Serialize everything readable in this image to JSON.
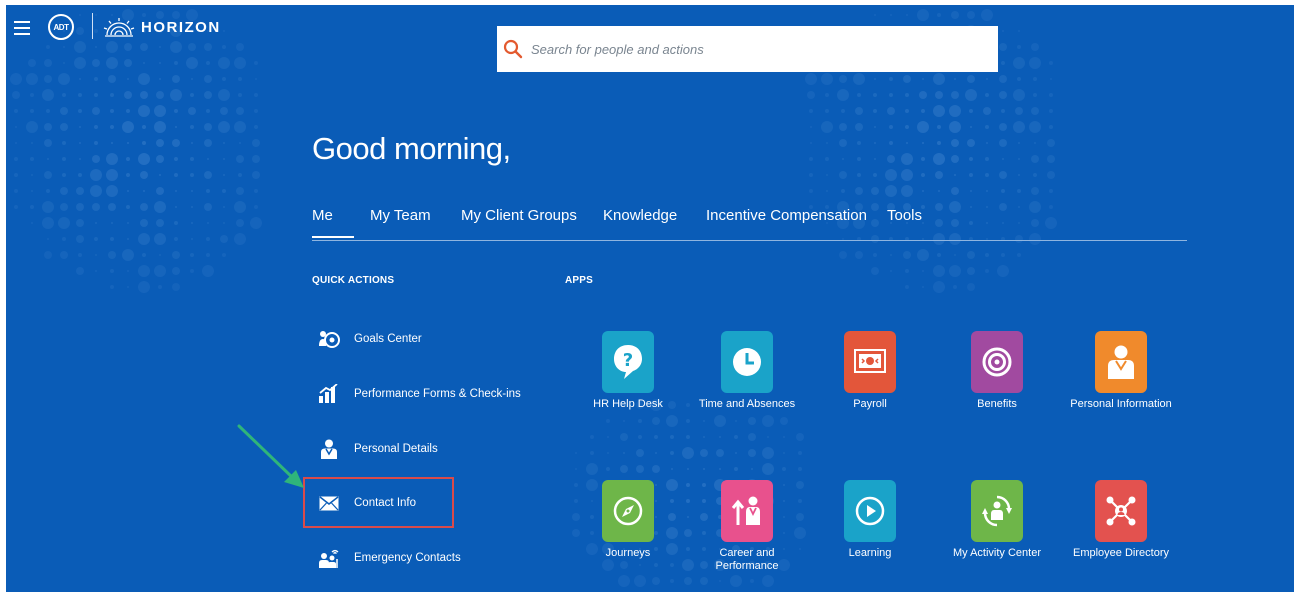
{
  "header": {
    "brand": "HORIZON",
    "adt_logo": "ADT",
    "search_placeholder": "Search for people and actions"
  },
  "greeting": "Good morning,",
  "tabs": [
    {
      "label": "Me",
      "active": true
    },
    {
      "label": "My Team"
    },
    {
      "label": "My Client Groups"
    },
    {
      "label": "Knowledge"
    },
    {
      "label": "Incentive Compensation"
    },
    {
      "label": "Tools"
    }
  ],
  "quick_actions": {
    "title": "QUICK ACTIONS",
    "items": [
      {
        "label": "Goals Center",
        "icon": "goals-icon"
      },
      {
        "label": "Performance Forms & Check-ins",
        "icon": "performance-icon"
      },
      {
        "label": "Personal Details",
        "icon": "person-icon"
      },
      {
        "label": "Contact Info",
        "icon": "envelope-icon",
        "highlighted": true
      },
      {
        "label": "Emergency Contacts",
        "icon": "emergency-contacts-icon"
      }
    ]
  },
  "apps": {
    "title": "APPS",
    "items": [
      {
        "label": "HR Help Desk",
        "icon": "help-icon",
        "color": "#1aa3c9"
      },
      {
        "label": "Time and Absences",
        "icon": "clock-icon",
        "color": "#1aa3c9"
      },
      {
        "label": "Payroll",
        "icon": "money-icon",
        "color": "#e3563a"
      },
      {
        "label": "Benefits",
        "icon": "target-icon",
        "color": "#a14aa0"
      },
      {
        "label": "Personal Information",
        "icon": "person-icon",
        "color": "#f08a2c"
      },
      {
        "label": "Journeys",
        "icon": "compass-icon",
        "color": "#6eb649"
      },
      {
        "label": "Career and Performance",
        "icon": "career-icon",
        "color": "#e8518d"
      },
      {
        "label": "Learning",
        "icon": "play-icon",
        "color": "#1aa3c9"
      },
      {
        "label": "My Activity Center",
        "icon": "activity-icon",
        "color": "#6eb649"
      },
      {
        "label": "Employee Directory",
        "icon": "network-icon",
        "color": "#e3524f"
      }
    ]
  },
  "colors": {
    "background": "#0a5cb7",
    "highlight_border": "#d94b4b",
    "arrow": "#2fb57a",
    "search_icon": "#e35a2f"
  }
}
